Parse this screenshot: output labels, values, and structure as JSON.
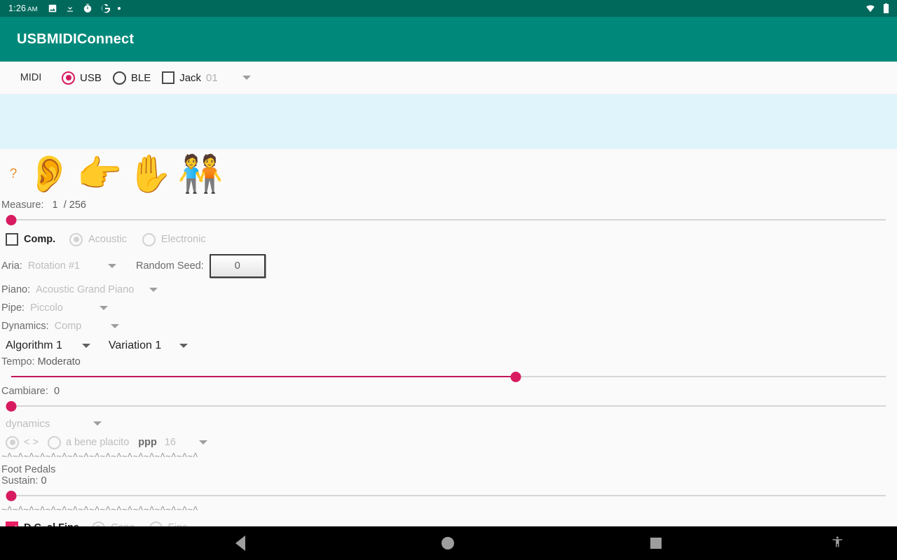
{
  "statusbar": {
    "time": "1:26",
    "ampm": "AM",
    "icons": [
      "image-icon",
      "download-icon",
      "timer-icon",
      "google-icon",
      "dot-icon"
    ],
    "right_icons": [
      "wifi-icon",
      "battery-icon"
    ]
  },
  "appbar": {
    "title": "USBMIDIConnect"
  },
  "midi": {
    "label": "MIDI",
    "usb_label": "USB",
    "usb_selected": true,
    "ble_label": "BLE",
    "ble_selected": false,
    "jack_label": "Jack",
    "jack_checked": false,
    "jack_port": "01"
  },
  "emoji_row": {
    "question": "?",
    "items": [
      {
        "name": "ear-emoji",
        "glyph": "👂"
      },
      {
        "name": "pointing-right-emoji",
        "glyph": "👉"
      },
      {
        "name": "raised-hand-emoji",
        "glyph": "✋"
      },
      {
        "name": "people-holding-hands-emoji",
        "glyph": "🧑‍🤝‍🧑"
      }
    ]
  },
  "measure": {
    "label": "Measure:",
    "current": "1",
    "separator": "/",
    "total": "256",
    "slider_percent": 0
  },
  "comp": {
    "label": "Comp.",
    "checked": false,
    "acoustic_label": "Acoustic",
    "acoustic_selected": true,
    "electronic_label": "Electronic",
    "electronic_selected": false
  },
  "aria": {
    "label": "Aria:",
    "value": "Rotation #1",
    "seed_label": "Random Seed:",
    "seed_value": "0"
  },
  "instruments": {
    "piano_label": "Piano:",
    "piano_value": "Acoustic Grand Piano",
    "pipe_label": "Pipe:",
    "pipe_value": "Piccolo",
    "dynamics_label": "Dynamics:",
    "dynamics_value": "Comp",
    "algorithm_value": "Algorithm 1",
    "variation_value": "Variation 1"
  },
  "tempo": {
    "label": "Tempo:",
    "value": "Moderato",
    "slider_percent": 57
  },
  "cambiare": {
    "label": "Cambiare:",
    "value": "0",
    "slider_percent": 0
  },
  "dynamics_section": {
    "dropdown_value": "dynamics",
    "arrows_label": "< >",
    "arrows_selected": true,
    "abeneplacito_label": "a bene placito",
    "abeneplacito_selected": false,
    "ppp_label": "ppp",
    "ppp_count": "16"
  },
  "separator": "~^~^~^~^~^~^~^~^~^~^~^~^~^~^~^~^~^~^",
  "foot_pedals": {
    "title": "Foot Pedals",
    "sustain_label": "Sustain:",
    "sustain_value": "0",
    "slider_percent": 0
  },
  "repeat": {
    "dc_al_fine_label": "D.C. al Fine",
    "dc_al_fine_checked": true,
    "capo_label": "Capo",
    "capo_selected": true,
    "fine_label": "Fine",
    "fine_selected": false
  },
  "navbar": {
    "back": "back-button",
    "home": "home-button",
    "recents": "recents-button",
    "accessibility": "accessibility-button"
  },
  "colors": {
    "appbar": "#00897b",
    "statusbar": "#00695c",
    "accent_pink": "#d81b60",
    "panel_blue": "#e0f4fb"
  }
}
